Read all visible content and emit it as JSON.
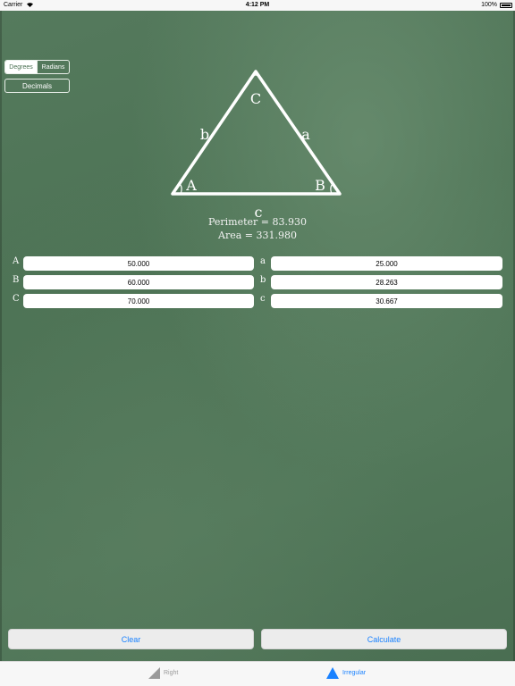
{
  "status_bar": {
    "carrier": "Carrier",
    "time": "4:12 PM",
    "battery": "100%"
  },
  "angle_mode": {
    "options": [
      "Degrees",
      "Radians"
    ],
    "selected": "Degrees"
  },
  "decimals_label": "Decimals",
  "triangle": {
    "vertex_labels": [
      "A",
      "B",
      "C"
    ],
    "side_labels": [
      "a",
      "b",
      "c"
    ]
  },
  "results": {
    "perimeter": "Perimeter = 83.930",
    "area": "Area = 331.980"
  },
  "angles": [
    {
      "label": "A",
      "value": "50.000"
    },
    {
      "label": "B",
      "value": "60.000"
    },
    {
      "label": "C",
      "value": "70.000"
    }
  ],
  "sides": [
    {
      "label": "a",
      "value": "25.000"
    },
    {
      "label": "b",
      "value": "28.263"
    },
    {
      "label": "c",
      "value": "30.667"
    }
  ],
  "buttons": {
    "clear": "Clear",
    "calculate": "Calculate"
  },
  "tabs": [
    {
      "label": "Right",
      "icon": "right-triangle-icon",
      "active": false
    },
    {
      "label": "Irregular",
      "icon": "triangle-icon",
      "active": true
    }
  ],
  "colors": {
    "chalkboard": "#4c7254",
    "accent": "#1a82ff",
    "inactive_tab": "#9a9a9a"
  }
}
